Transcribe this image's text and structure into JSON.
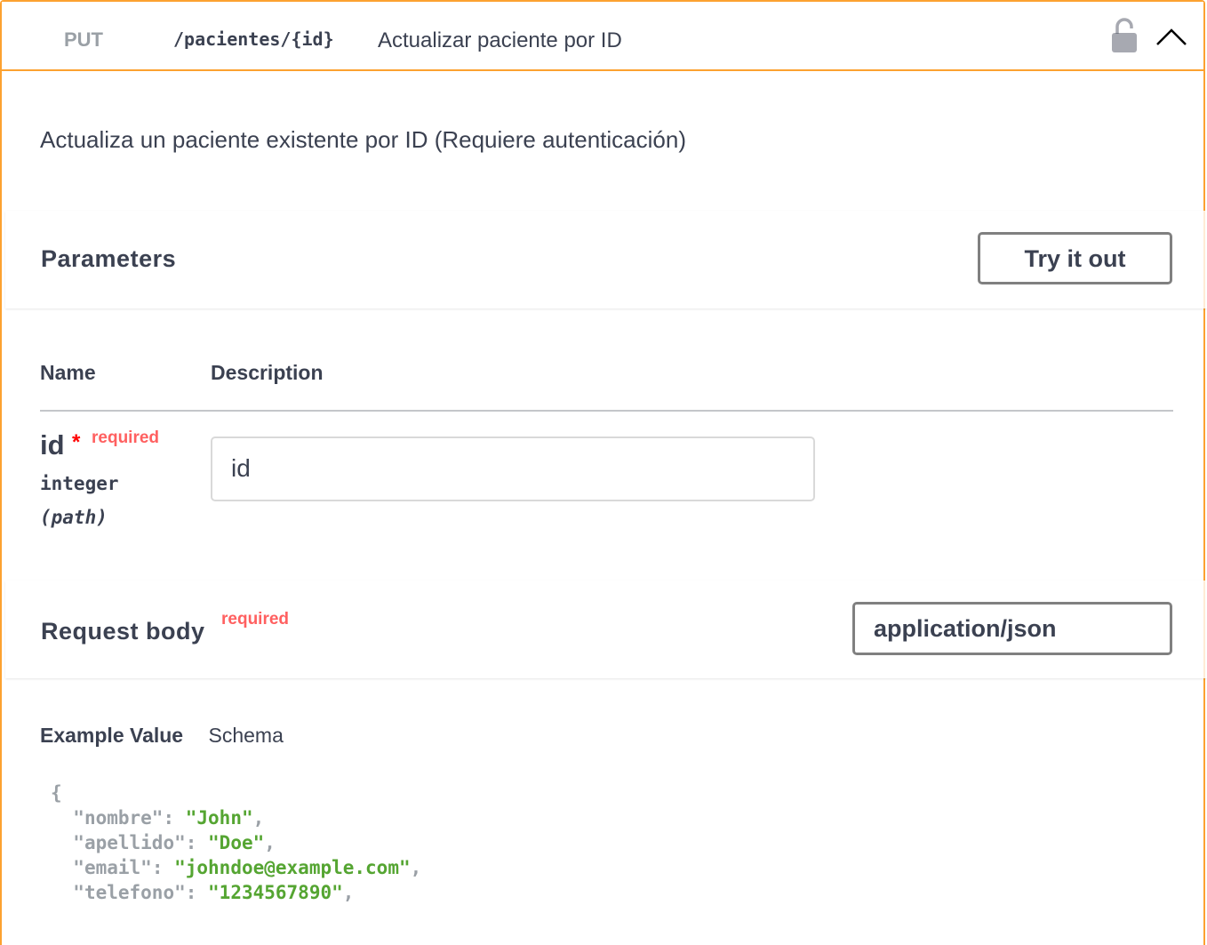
{
  "operation": {
    "method": "PUT",
    "path": "/pacientes/{id}",
    "summary": "Actualizar paciente por ID",
    "description": "Actualiza un paciente existente por ID (Requiere autenticación)",
    "lock_icon": "lock-open-icon",
    "collapse_icon": "chevron-up-icon"
  },
  "parameters": {
    "title": "Parameters",
    "try_button": "Try it out",
    "col_name": "Name",
    "col_description": "Description",
    "items": [
      {
        "name": "id",
        "required_star": "*",
        "required_label": "required",
        "type": "integer",
        "in": "(path)",
        "placeholder": "id"
      }
    ]
  },
  "request_body": {
    "title": "Request body",
    "required_label": "required",
    "content_type": "application/json",
    "tab_example": "Example Value",
    "tab_schema": "Schema",
    "example": {
      "open": "{",
      "fields": [
        {
          "key": "\"nombre\"",
          "value": "\"John\""
        },
        {
          "key": "\"apellido\"",
          "value": "\"Doe\""
        },
        {
          "key": "\"email\"",
          "value": "\"johndoe@example.com\""
        },
        {
          "key": "\"telefono\"",
          "value": "\"1234567890\""
        }
      ]
    }
  },
  "colors": {
    "put_accent": "#fca130",
    "required_red": "#ff0000",
    "string_green": "#55a532"
  }
}
